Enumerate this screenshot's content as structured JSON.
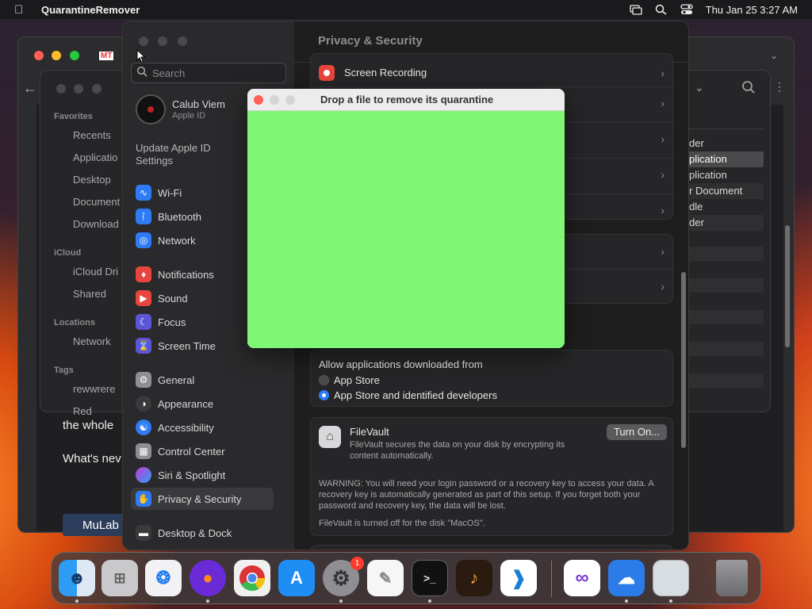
{
  "menubar": {
    "app_name": "QuarantineRemover",
    "clock": "Thu Jan 25  3:27 AM"
  },
  "browser": {
    "tab_text": "MT",
    "body_line1": "the whole",
    "body_line2": "What's nev",
    "footer_button": "MuLab"
  },
  "finder": {
    "favorites_header": "Favorites",
    "favorites": [
      "Recents",
      "Applicatio",
      "Desktop",
      "Document",
      "Download"
    ],
    "icloud_header": "iCloud",
    "icloud": [
      "iCloud Dri",
      "Shared"
    ],
    "locations_header": "Locations",
    "locations": [
      "Network"
    ],
    "tags_header": "Tags",
    "tags": [
      "rewwrere",
      "Red"
    ],
    "right_list": [
      "der",
      "plication",
      "plication",
      "r Document",
      "dle",
      "der"
    ]
  },
  "settings": {
    "search_placeholder": "Search",
    "account_name": "Calub Viem",
    "account_sub": "Apple ID",
    "update_apple_id": "Update Apple ID Settings",
    "title": "Privacy & Security",
    "sidebar": [
      {
        "label": "Wi-Fi",
        "icon": "wifi-icon",
        "color": "#2f7bf6"
      },
      {
        "label": "Bluetooth",
        "icon": "bluetooth-icon",
        "color": "#2f7bf6"
      },
      {
        "label": "Network",
        "icon": "globe-icon",
        "color": "#2f7bf6"
      },
      {
        "label": "Notifications",
        "icon": "bell-icon",
        "color": "#e8453c"
      },
      {
        "label": "Sound",
        "icon": "speaker-icon",
        "color": "#e8453c"
      },
      {
        "label": "Focus",
        "icon": "moon-icon",
        "color": "#5b56d6"
      },
      {
        "label": "Screen Time",
        "icon": "hourglass-icon",
        "color": "#5b56d6"
      },
      {
        "label": "General",
        "icon": "gear-icon",
        "color": "#8e8e93"
      },
      {
        "label": "Appearance",
        "icon": "appearance-icon",
        "color": "#3a3a3c"
      },
      {
        "label": "Accessibility",
        "icon": "accessibility-icon",
        "color": "#2f7bf6"
      },
      {
        "label": "Control Center",
        "icon": "control-center-icon",
        "color": "#8e8e93"
      },
      {
        "label": "Siri & Spotlight",
        "icon": "siri-icon",
        "color": "#c13ad6"
      },
      {
        "label": "Privacy & Security",
        "icon": "hand-icon",
        "color": "#2f7bf6"
      },
      {
        "label": "Desktop & Dock",
        "icon": "dock-icon",
        "color": "#3a3a3c"
      }
    ],
    "screen_recording": "Screen Recording",
    "allow_heading": "Allow applications downloaded from",
    "radio_app_store": "App Store",
    "radio_identified": "App Store and identified developers",
    "filevault_title": "FileVault",
    "filevault_desc": "FileVault secures the data on your disk by encrypting its content automatically.",
    "turn_on": "Turn On...",
    "warning": "WARNING: You will need your login password or a recovery key to access your data. A recovery key is automatically generated as part of this setup. If you forget both your password and recovery key, the data will be lost.",
    "filevault_status": "FileVault is turned off for the disk \"MacOS\"."
  },
  "dialog": {
    "title": "Drop a file to remove its quarantine",
    "dropzone_color": "#7ff774"
  },
  "dock": {
    "badge": "1",
    "apps": [
      {
        "name": "finder-icon"
      },
      {
        "name": "launchpad-icon"
      },
      {
        "name": "safari-icon"
      },
      {
        "name": "firefox-icon"
      },
      {
        "name": "chrome-icon"
      },
      {
        "name": "app-store-icon"
      },
      {
        "name": "system-settings-icon"
      },
      {
        "name": "textedit-icon"
      },
      {
        "name": "terminal-icon"
      },
      {
        "name": "garageband-icon"
      },
      {
        "name": "vscode-icon"
      },
      {
        "name": "visual-studio-icon"
      },
      {
        "name": "weather-icon"
      },
      {
        "name": "preview-icon"
      },
      {
        "name": "trash-icon"
      }
    ]
  }
}
